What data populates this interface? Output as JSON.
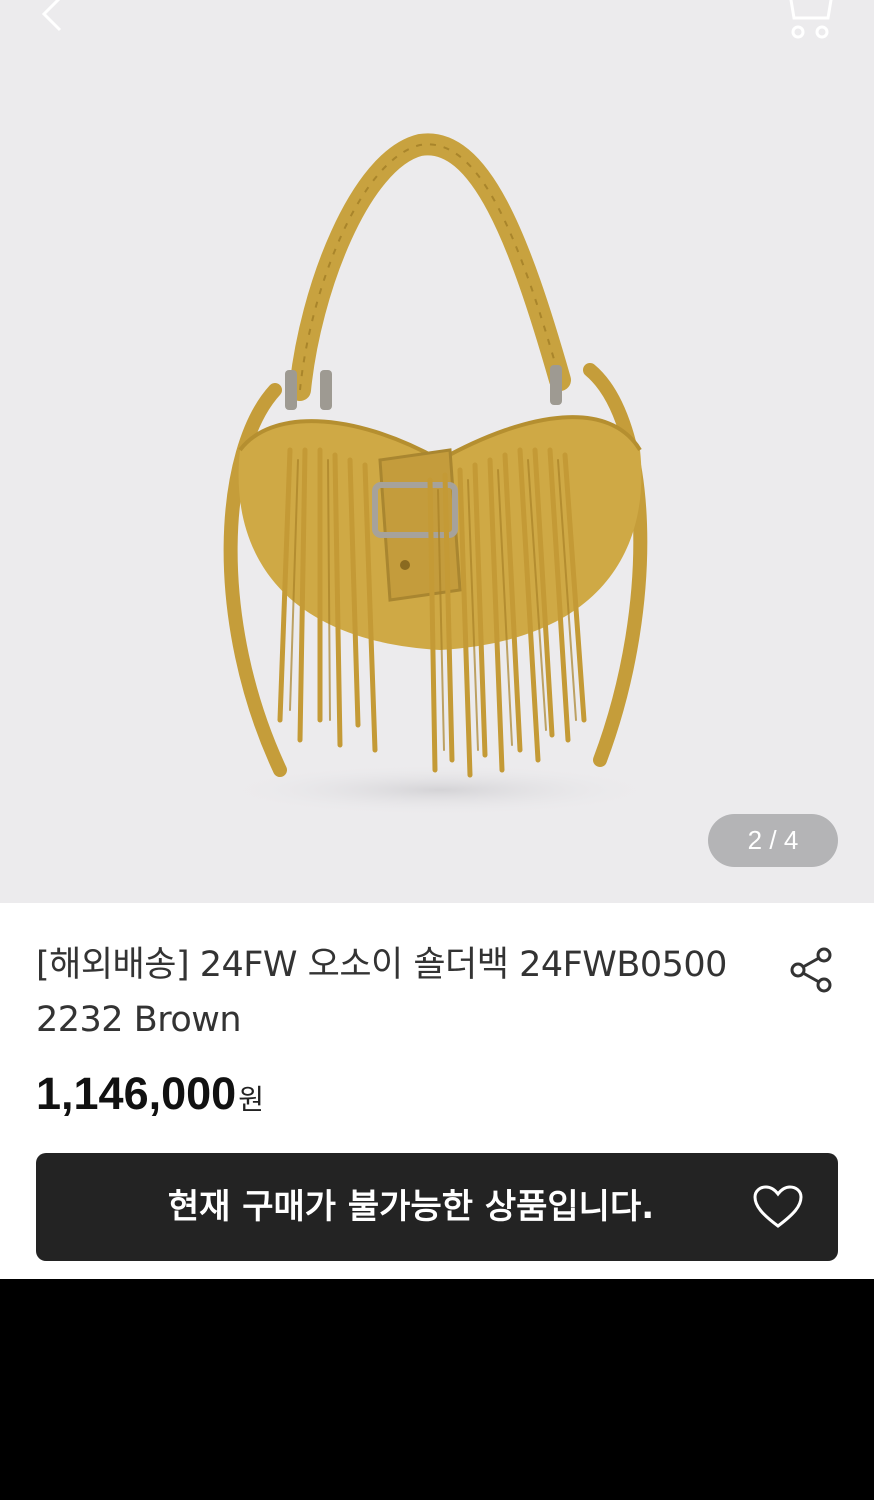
{
  "header": {
    "back_icon": "chevron-left-icon",
    "cart_icon": "cart-icon"
  },
  "gallery": {
    "current": "2",
    "separator": "/",
    "total": "4"
  },
  "product": {
    "title": "[해외배송] 24FW 오소이 숄더백 24FWB0500 2232 Brown",
    "price": "1,146,000",
    "currency": "원"
  },
  "actions": {
    "share_icon": "share-icon",
    "purchase_label": "현재 구매가 불가능한 상품입니다.",
    "wishlist_icon": "heart-icon"
  },
  "colors": {
    "hero_bg": "#ecebed",
    "bag": "#c9a040",
    "cta_bg": "#232323",
    "pager_bg": "#b4b4b6"
  }
}
